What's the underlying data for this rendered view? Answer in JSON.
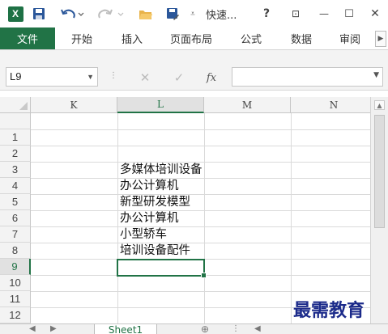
{
  "titlebar": {
    "app_icon": "excel-icon",
    "app_letter": "X",
    "title": "快速...",
    "help": "?",
    "restore": "⊡",
    "minimize": "—",
    "maximize": "☐",
    "close": "✕"
  },
  "ribbon": {
    "tabs": [
      "文件",
      "开始",
      "插入",
      "页面布局",
      "公式",
      "数据",
      "审阅"
    ],
    "accent": "#217346"
  },
  "formula_bar": {
    "name_box": "L9",
    "cancel": "✕",
    "enter": "✓",
    "fx": "fx",
    "value": ""
  },
  "grid": {
    "columns": [
      "K",
      "L",
      "M",
      "N"
    ],
    "active_column": "L",
    "rows": [
      "1",
      "2",
      "3",
      "4",
      "5",
      "6",
      "7",
      "8",
      "9",
      "10",
      "11",
      "12"
    ],
    "active_row": "9",
    "cells": [
      {
        "row": "3",
        "col": "L",
        "value": "多媒体培训设备"
      },
      {
        "row": "4",
        "col": "L",
        "value": "办公计算机"
      },
      {
        "row": "5",
        "col": "L",
        "value": "新型研发模型"
      },
      {
        "row": "6",
        "col": "L",
        "value": "办公计算机"
      },
      {
        "row": "7",
        "col": "L",
        "value": "小型轿车"
      },
      {
        "row": "8",
        "col": "L",
        "value": "培训设备配件"
      }
    ]
  },
  "sheets": {
    "active": "Sheet1"
  },
  "watermark": "最需教育"
}
